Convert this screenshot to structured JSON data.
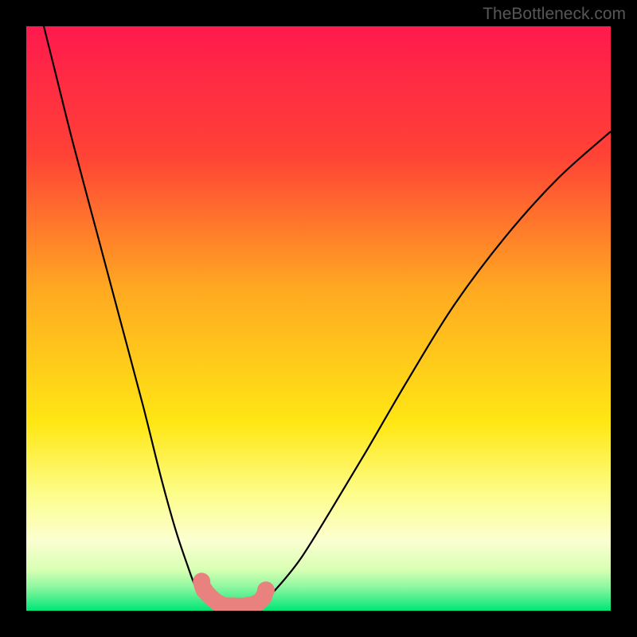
{
  "watermark": "TheBottleneck.com",
  "chart_data": {
    "type": "line",
    "title": "",
    "xlabel": "",
    "ylabel": "",
    "xlim": [
      0,
      100
    ],
    "ylim": [
      0,
      100
    ],
    "grid": false,
    "series": [
      {
        "name": "left-curve",
        "x": [
          3,
          5,
          8,
          12,
          16,
          20,
          23,
          25.5,
          27.5,
          29,
          30.5,
          32,
          33.5
        ],
        "values": [
          100,
          92,
          80,
          65,
          50,
          35,
          23,
          14,
          8,
          4,
          2,
          1,
          0.5
        ]
      },
      {
        "name": "right-curve",
        "x": [
          40,
          43,
          47,
          52,
          58,
          65,
          73,
          82,
          91,
          100
        ],
        "values": [
          1,
          4,
          9,
          17,
          27,
          39,
          52,
          64,
          74,
          82
        ]
      },
      {
        "name": "bottom-markers",
        "x": [
          30,
          30.5,
          33,
          35.5,
          38,
          39.5,
          40.5,
          41
        ],
        "values": [
          5,
          3.5,
          1.2,
          0.8,
          0.9,
          1.3,
          2.2,
          3.5
        ]
      }
    ],
    "background": {
      "type": "vertical-gradient",
      "stops": [
        {
          "offset": 0.0,
          "color": "#ff1a4d"
        },
        {
          "offset": 0.22,
          "color": "#ff4236"
        },
        {
          "offset": 0.45,
          "color": "#ffa921"
        },
        {
          "offset": 0.68,
          "color": "#ffe714"
        },
        {
          "offset": 0.8,
          "color": "#fdfd8a"
        },
        {
          "offset": 0.88,
          "color": "#fbffd1"
        },
        {
          "offset": 0.93,
          "color": "#d8ffb3"
        },
        {
          "offset": 0.96,
          "color": "#8cf7a0"
        },
        {
          "offset": 1.0,
          "color": "#00e676"
        }
      ]
    }
  }
}
